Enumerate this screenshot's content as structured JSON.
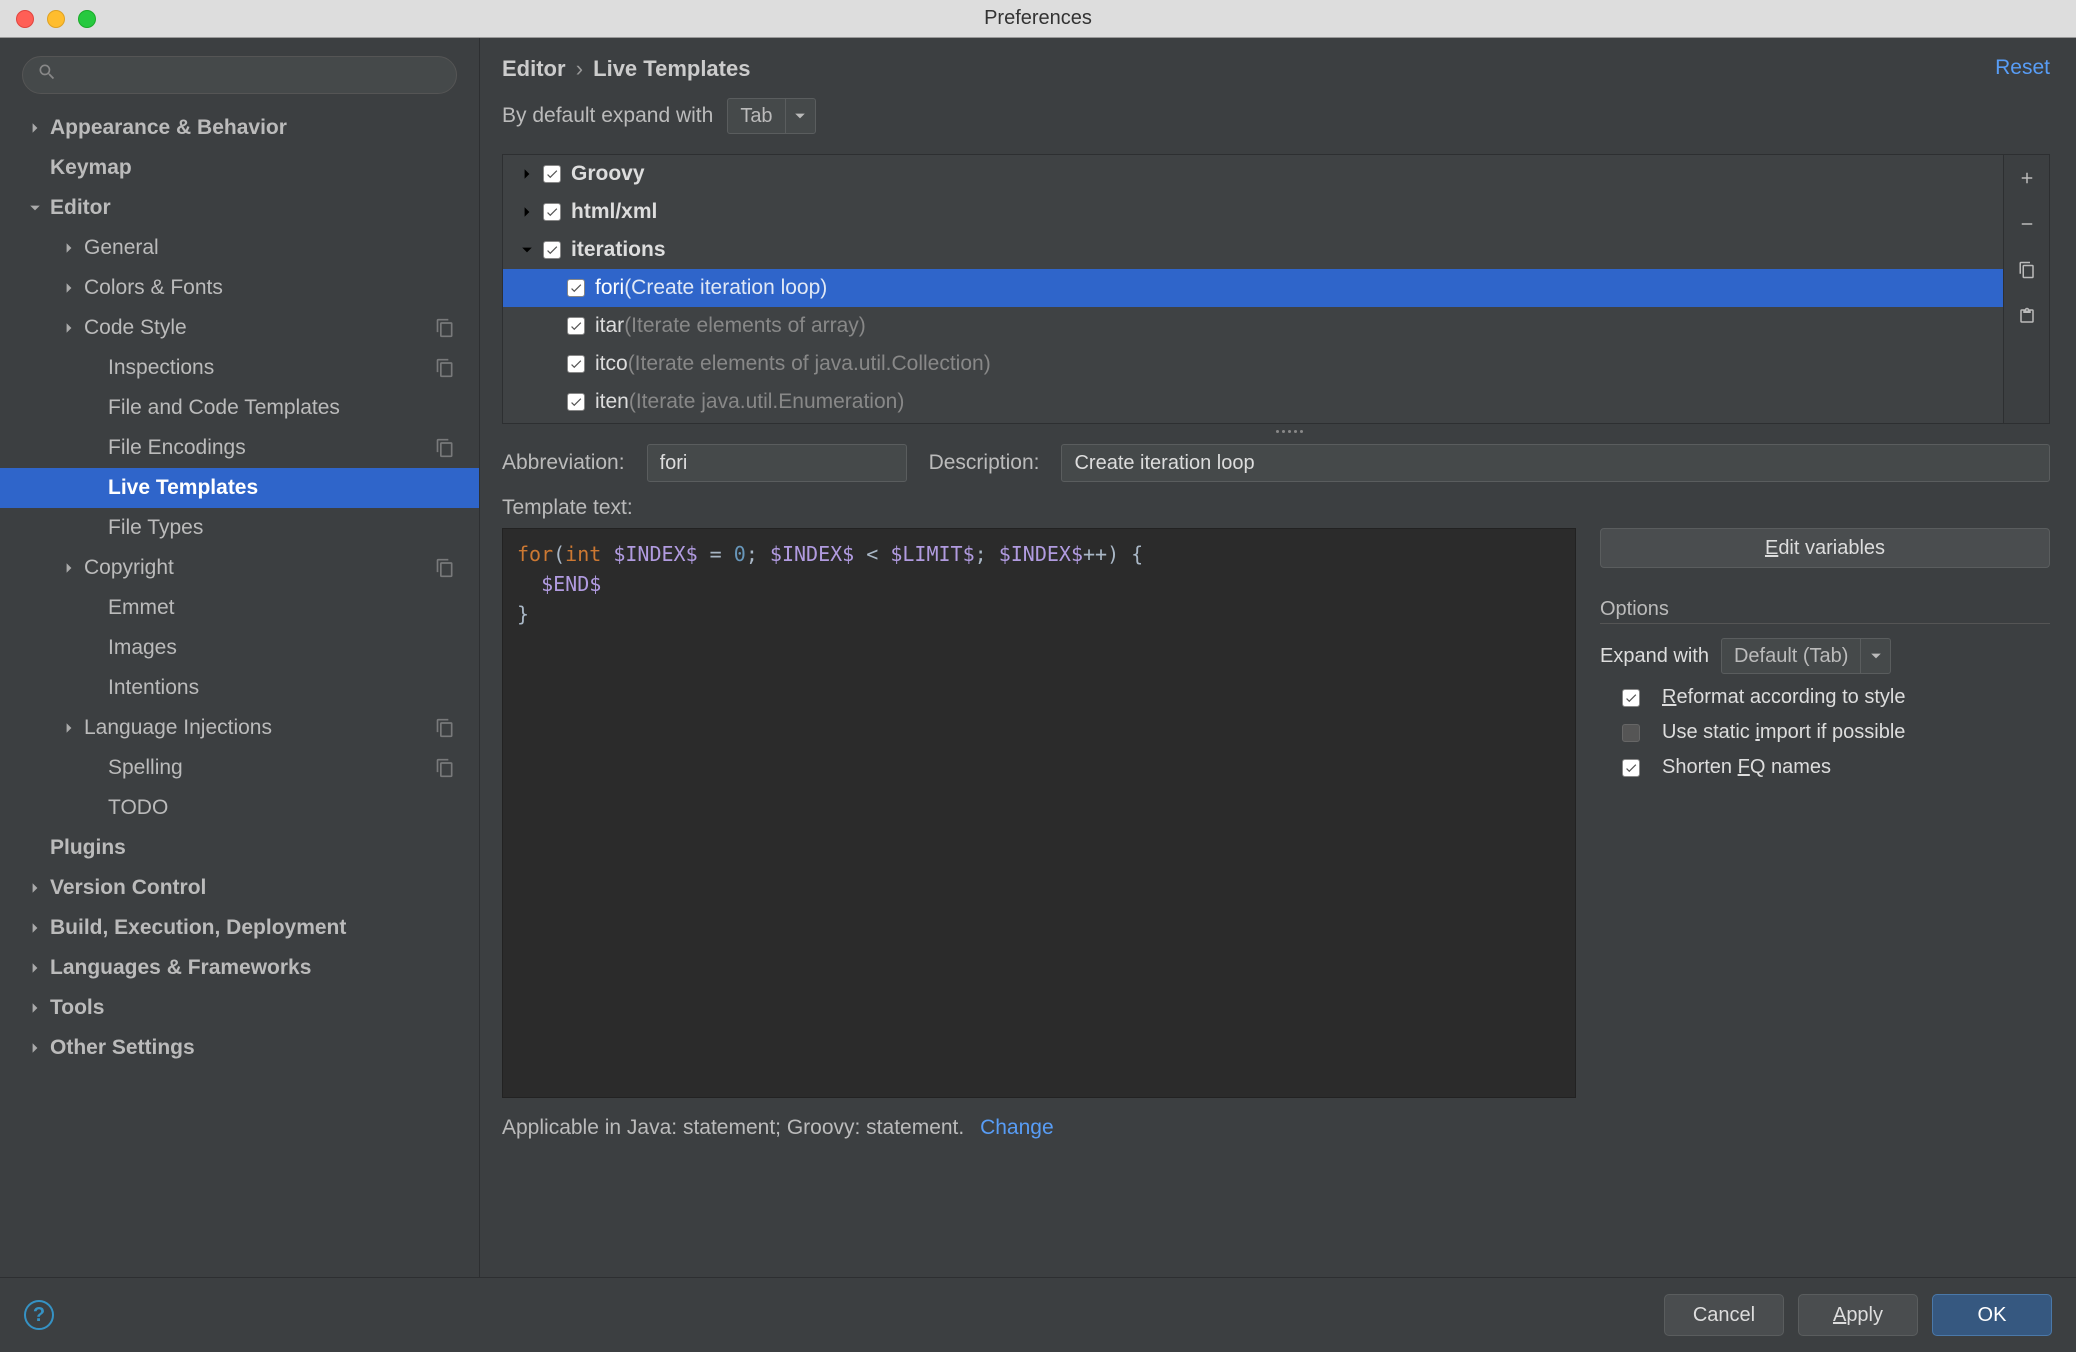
{
  "window": {
    "title": "Preferences"
  },
  "breadcrumb": {
    "a": "Editor",
    "b": "Live Templates"
  },
  "reset": "Reset",
  "search": {
    "placeholder": ""
  },
  "sidebar": {
    "items": [
      {
        "label": "Appearance & Behavior",
        "level": 0,
        "arrow": "right",
        "bold": true
      },
      {
        "label": "Keymap",
        "level": 0,
        "bold": true
      },
      {
        "label": "Editor",
        "level": 0,
        "arrow": "down",
        "bold": true
      },
      {
        "label": "General",
        "level": 1,
        "arrow": "right"
      },
      {
        "label": "Colors & Fonts",
        "level": 1,
        "arrow": "right"
      },
      {
        "label": "Code Style",
        "level": 1,
        "arrow": "right",
        "trail": true
      },
      {
        "label": "Inspections",
        "level": 2,
        "trail": true
      },
      {
        "label": "File and Code Templates",
        "level": 2
      },
      {
        "label": "File Encodings",
        "level": 2,
        "trail": true
      },
      {
        "label": "Live Templates",
        "level": 2,
        "selected": true
      },
      {
        "label": "File Types",
        "level": 2
      },
      {
        "label": "Copyright",
        "level": 1,
        "arrow": "right",
        "trail": true
      },
      {
        "label": "Emmet",
        "level": 2
      },
      {
        "label": "Images",
        "level": 2
      },
      {
        "label": "Intentions",
        "level": 2
      },
      {
        "label": "Language Injections",
        "level": 1,
        "arrow": "right",
        "trail": true
      },
      {
        "label": "Spelling",
        "level": 2,
        "trail": true
      },
      {
        "label": "TODO",
        "level": 2
      },
      {
        "label": "Plugins",
        "level": 0,
        "bold": true
      },
      {
        "label": "Version Control",
        "level": 0,
        "arrow": "right",
        "bold": true
      },
      {
        "label": "Build, Execution, Deployment",
        "level": 0,
        "arrow": "right",
        "bold": true
      },
      {
        "label": "Languages & Frameworks",
        "level": 0,
        "arrow": "right",
        "bold": true
      },
      {
        "label": "Tools",
        "level": 0,
        "arrow": "right",
        "bold": true
      },
      {
        "label": "Other Settings",
        "level": 0,
        "arrow": "right",
        "bold": true
      }
    ]
  },
  "expand": {
    "label": "By default expand with",
    "value": "Tab"
  },
  "templates": [
    {
      "label": "Groovy",
      "level": 0,
      "arrow": "right",
      "checked": true,
      "bold": true
    },
    {
      "label": "html/xml",
      "level": 0,
      "arrow": "right",
      "checked": true,
      "bold": true
    },
    {
      "label": "iterations",
      "level": 0,
      "arrow": "down",
      "checked": true,
      "bold": true
    },
    {
      "label": "fori",
      "desc": " (Create iteration loop)",
      "level": 1,
      "checked": true,
      "selected": true
    },
    {
      "label": "itar",
      "desc": " (Iterate elements of array)",
      "level": 1,
      "checked": true
    },
    {
      "label": "itco",
      "desc": " (Iterate elements of java.util.Collection)",
      "level": 1,
      "checked": true
    },
    {
      "label": "iten",
      "desc": " (Iterate java.util.Enumeration)",
      "level": 1,
      "checked": true
    }
  ],
  "form": {
    "abbr_label": "Abbreviation:",
    "abbr_value": "fori",
    "desc_label": "Description:",
    "desc_value": "Create iteration loop",
    "template_label": "Template text:",
    "editvars": "Edit variables"
  },
  "options": {
    "title": "Options",
    "expand_label": "Expand with",
    "expand_value": "Default (Tab)",
    "reformat": "Reformat according to style",
    "static_import": "Use static import if possible",
    "shorten": "Shorten FQ names",
    "reformat_checked": true,
    "static_checked": false,
    "shorten_checked": true
  },
  "applicable": {
    "text": "Applicable in Java: statement; Groovy: statement.",
    "change": "Change"
  },
  "footer": {
    "cancel": "Cancel",
    "apply": "Apply",
    "ok": "OK"
  }
}
